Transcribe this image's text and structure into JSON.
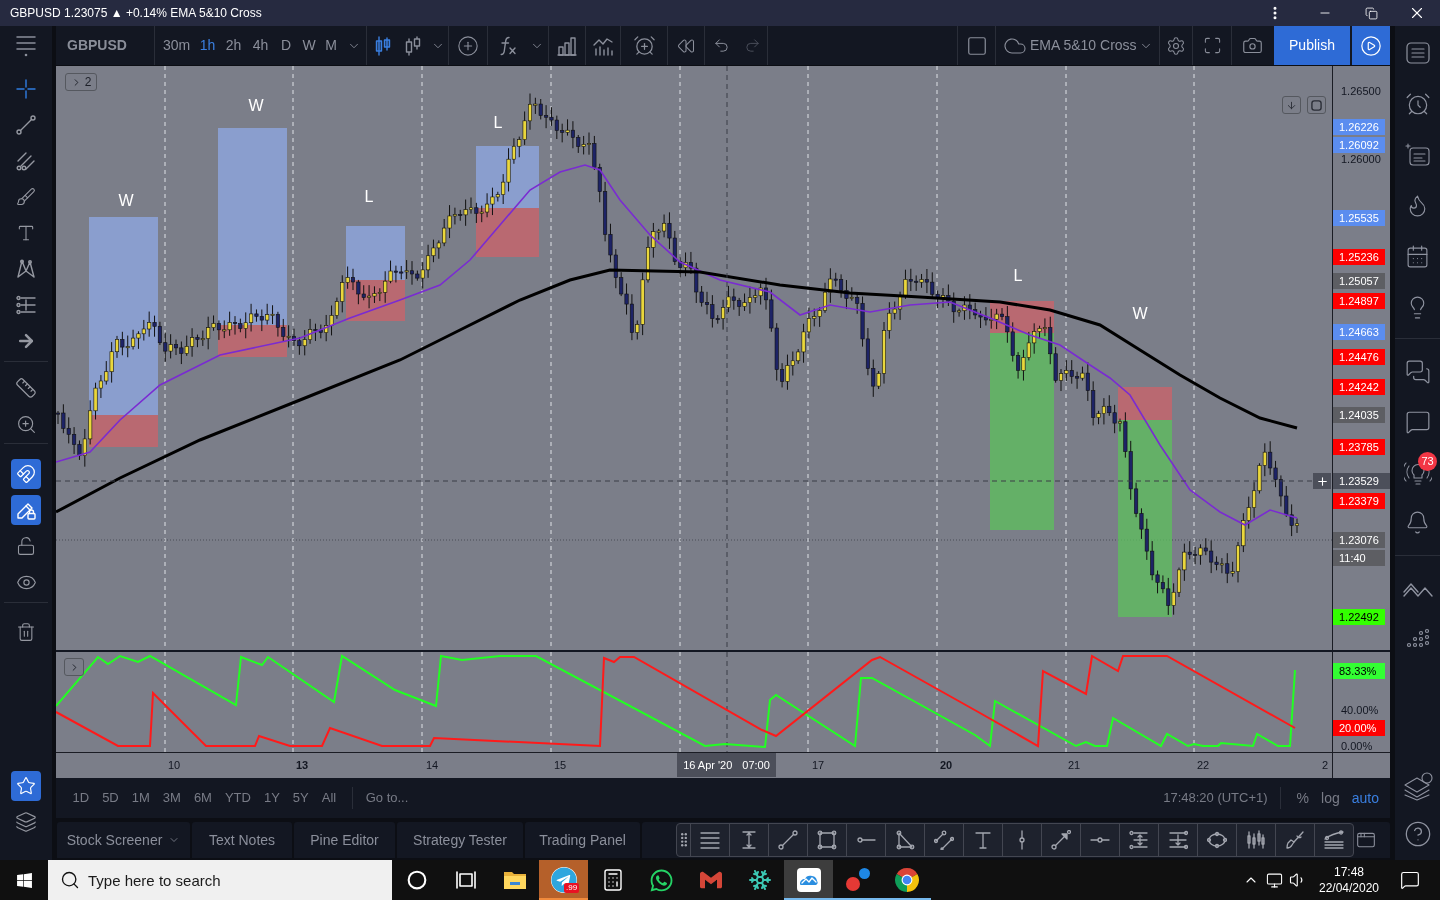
{
  "window": {
    "title": "GBPUSD 1.23075 ▲ +0.14% EMA 5&10 Cross"
  },
  "toolbar": {
    "symbol": "GBPUSD",
    "intervals": [
      {
        "label": "30m",
        "selected": false
      },
      {
        "label": "1h",
        "selected": true
      },
      {
        "label": "2h",
        "selected": false
      },
      {
        "label": "4h",
        "selected": false
      },
      {
        "label": "D",
        "selected": false
      },
      {
        "label": "W",
        "selected": false
      },
      {
        "label": "M",
        "selected": false
      }
    ],
    "chart_styles": [
      {
        "kind": "candles",
        "selected": true
      },
      {
        "kind": "bars",
        "selected": false
      }
    ],
    "undo_disabled": false,
    "redo_disabled": true,
    "layout_name": "EMA 5&10 Cross",
    "publish_label": "Publish"
  },
  "drawing_tools": [
    {
      "kind": "crosshair",
      "selected": true
    },
    {
      "kind": "trendline",
      "selected": false
    },
    {
      "kind": "pitchfork",
      "selected": false
    },
    {
      "kind": "brush",
      "selected": false
    },
    {
      "kind": "text",
      "selected": false
    },
    {
      "kind": "pattern",
      "selected": false
    },
    {
      "kind": "levels",
      "selected": false
    },
    {
      "kind": "arrow",
      "selected": false
    },
    {
      "kind": "ruler",
      "selected": false
    },
    {
      "kind": "zoom",
      "selected": false
    }
  ],
  "toggles": [
    {
      "kind": "magnet",
      "on": true
    },
    {
      "kind": "drawing-lock",
      "on": true
    },
    {
      "kind": "lock-all",
      "on": false
    },
    {
      "kind": "visibility",
      "on": false
    }
  ],
  "favorites_toolbar": {
    "on": true
  },
  "chart": {
    "indicator_count": "2",
    "trade_markers": [
      {
        "label": "W",
        "kind": "long"
      },
      {
        "label": "W",
        "kind": "long"
      },
      {
        "label": "L",
        "kind": "long"
      },
      {
        "label": "L",
        "kind": "long"
      },
      {
        "label": "L",
        "kind": "short"
      },
      {
        "label": "W",
        "kind": "short"
      }
    ],
    "price_axis": [
      {
        "label": "1.26500",
        "kind": "tick"
      },
      {
        "label": "1.26226",
        "kind": "tag",
        "color": "#5b8def"
      },
      {
        "label": "1.26092",
        "kind": "tag",
        "color": "#5b8def"
      },
      {
        "label": "1.26000",
        "kind": "tick"
      },
      {
        "label": "1.25535",
        "kind": "tag",
        "color": "#5b8def"
      },
      {
        "label": "1.25236",
        "kind": "tag",
        "color": "#ff0000"
      },
      {
        "label": "1.25057",
        "kind": "tag",
        "color": "#5d5e63"
      },
      {
        "label": "1.24897",
        "kind": "tag",
        "color": "#ff0000"
      },
      {
        "label": "1.24663",
        "kind": "tag",
        "color": "#5b8def"
      },
      {
        "label": "1.24476",
        "kind": "tag",
        "color": "#ff0000"
      },
      {
        "label": "1.24242",
        "kind": "tag",
        "color": "#ff0000"
      },
      {
        "label": "1.24035",
        "kind": "tag",
        "color": "#5d5e63"
      },
      {
        "label": "1.23785",
        "kind": "tag",
        "color": "#ff0000"
      },
      {
        "label": "1.23529",
        "kind": "crosshair"
      },
      {
        "label": "1.23379",
        "kind": "tag",
        "color": "#ff0000"
      },
      {
        "label": "1.23076",
        "kind": "tag",
        "color": "#5d5e63"
      },
      {
        "label": "11:40",
        "kind": "tag",
        "color": "#5d5e63"
      },
      {
        "label": "1.22492",
        "kind": "tag",
        "color": "#33ff00"
      }
    ],
    "oscillator_axis": [
      {
        "label": "83.33%",
        "kind": "tag",
        "color": "#33ff33"
      },
      {
        "label": "40.00%",
        "kind": "tick"
      },
      {
        "label": "20.00%",
        "kind": "tag",
        "color": "#ff0000"
      },
      {
        "label": "0.00%",
        "kind": "tick"
      }
    ],
    "time_axis": [
      {
        "label": "10",
        "bold": false
      },
      {
        "label": "13",
        "bold": true
      },
      {
        "label": "14",
        "bold": false
      },
      {
        "label": "15",
        "bold": false
      },
      {
        "label": "17",
        "bold": false
      },
      {
        "label": "20",
        "bold": true
      },
      {
        "label": "21",
        "bold": false
      },
      {
        "label": "22",
        "bold": false
      },
      {
        "label": "2",
        "bold": false
      }
    ],
    "crosshair_time": {
      "date": "16 Apr '20",
      "time": "07:00"
    }
  },
  "range_bar": {
    "ranges": [
      "1D",
      "5D",
      "1M",
      "3M",
      "6M",
      "YTD",
      "1Y",
      "5Y",
      "All"
    ],
    "goto": "Go to...",
    "clock": "17:48:20 (UTC+1)",
    "scale_options": [
      {
        "label": "%",
        "selected": false
      },
      {
        "label": "log",
        "selected": false
      },
      {
        "label": "auto",
        "selected": true
      }
    ]
  },
  "bottom_tabs": [
    {
      "label": "Stock Screener",
      "kind": "menu"
    },
    {
      "label": "Text Notes",
      "kind": "tab"
    },
    {
      "label": "Pine Editor",
      "kind": "tab"
    },
    {
      "label": "Strategy Tester",
      "kind": "tab"
    },
    {
      "label": "Trading Panel",
      "kind": "tab"
    }
  ],
  "right_sidebar": {
    "badge": "73"
  },
  "taskbar": {
    "search": {
      "placeholder": "Type here to search"
    },
    "apps": [
      {
        "kind": "explorer",
        "running": false,
        "active": false,
        "attention": false
      },
      {
        "kind": "telegram",
        "running": true,
        "active": false,
        "attention": true,
        "badge": ".99"
      },
      {
        "kind": "calculator",
        "running": false,
        "active": false,
        "attention": false
      },
      {
        "kind": "whatsapp",
        "running": false,
        "active": false,
        "attention": false
      },
      {
        "kind": "gmail",
        "running": false,
        "active": false,
        "attention": false
      },
      {
        "kind": "snowflake",
        "running": false,
        "active": false,
        "attention": false
      },
      {
        "kind": "tradingview",
        "running": true,
        "active": true,
        "attention": false
      },
      {
        "kind": "dots",
        "running": true,
        "active": false,
        "attention": false
      },
      {
        "kind": "chrome",
        "running": true,
        "active": false,
        "attention": false
      }
    ],
    "time": "17:48",
    "date": "22/04/2020"
  }
}
